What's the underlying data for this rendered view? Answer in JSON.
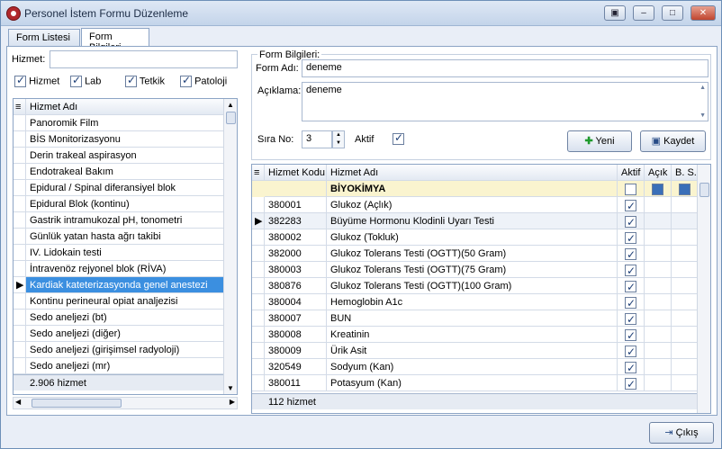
{
  "window": {
    "title": "Personel İstem Formu Düzenleme"
  },
  "tabs": [
    {
      "label": "Form Listesi"
    },
    {
      "label": "Form Bilgileri"
    }
  ],
  "left": {
    "hizmet_label": "Hizmet:",
    "hizmet_value": "",
    "filters": [
      {
        "label": "Hizmet",
        "on": true
      },
      {
        "label": "Lab",
        "on": true
      },
      {
        "label": "Tetkik",
        "on": true
      },
      {
        "label": "Patoloji",
        "on": true
      }
    ],
    "col_header": "Hizmet Adı",
    "items": [
      "Panoromik Film",
      "BİS Monitorizasyonu",
      "Derin trakeal aspirasyon",
      "Endotrakeal Bakım",
      "Epidural / Spinal diferansiyel blok",
      "Epidural Blok (kontinu)",
      "Gastrik intramukozal pH, tonometri",
      "Günlük yatan hasta ağrı takibi",
      "IV. Lidokain testi",
      "İntravenöz rejyonel blok (RİVA)",
      "Kardiak kateterizasyonda genel anestezi",
      "Kontinu perineural opiat analjezisi",
      "Sedo anelјezi (bt)",
      "Sedo anelјezi (diğer)",
      "Sedo anelјezi (girişimsel radyoloji)",
      "Sedo anelјezi (mr)"
    ],
    "selected_index": 10,
    "footer": "2.906 hizmet"
  },
  "form": {
    "group_title": "Form Bilgileri:",
    "ad_label": "Form Adı:",
    "ad_value": "deneme",
    "aciklama_label": "Açıklama:",
    "aciklama_value": "deneme",
    "sira_label": "Sıra No:",
    "sira_value": "3",
    "aktif_label": "Aktif",
    "yeni_label": "Yeni",
    "kaydet_label": "Kaydet"
  },
  "right_grid": {
    "headers": {
      "kod": "Hizmet Kodu",
      "ad": "Hizmet Adı",
      "aktif": "Aktif",
      "acik": "Açık",
      "bs": "B. S."
    },
    "group_row": "BİYOKİMYA",
    "rows": [
      {
        "kod": "380001",
        "ad": "Glukoz (Açlık)"
      },
      {
        "kod": "382283",
        "ad": "Büyüme Hormonu Klodinli Uyarı Testi"
      },
      {
        "kod": "380002",
        "ad": "Glukoz (Tokluk)"
      },
      {
        "kod": "382000",
        "ad": "Glukoz Tolerans Testi (OGTT)(50 Gram)"
      },
      {
        "kod": "380003",
        "ad": "Glukoz Tolerans Testi (OGTT)(75 Gram)"
      },
      {
        "kod": "380876",
        "ad": "Glukoz Tolerans Testi (OGTT)(100 Gram)"
      },
      {
        "kod": "380004",
        "ad": "Hemoglobin A1c"
      },
      {
        "kod": "380007",
        "ad": "BUN"
      },
      {
        "kod": "380008",
        "ad": "Kreatinin"
      },
      {
        "kod": "380009",
        "ad": "Ürik Asit"
      },
      {
        "kod": "320549",
        "ad": "Sodyum (Kan)"
      },
      {
        "kod": "380011",
        "ad": "Potasyum (Kan)"
      }
    ],
    "current_row": 1,
    "footer": "112 hizmet"
  },
  "cikis_label": "Çıkış"
}
